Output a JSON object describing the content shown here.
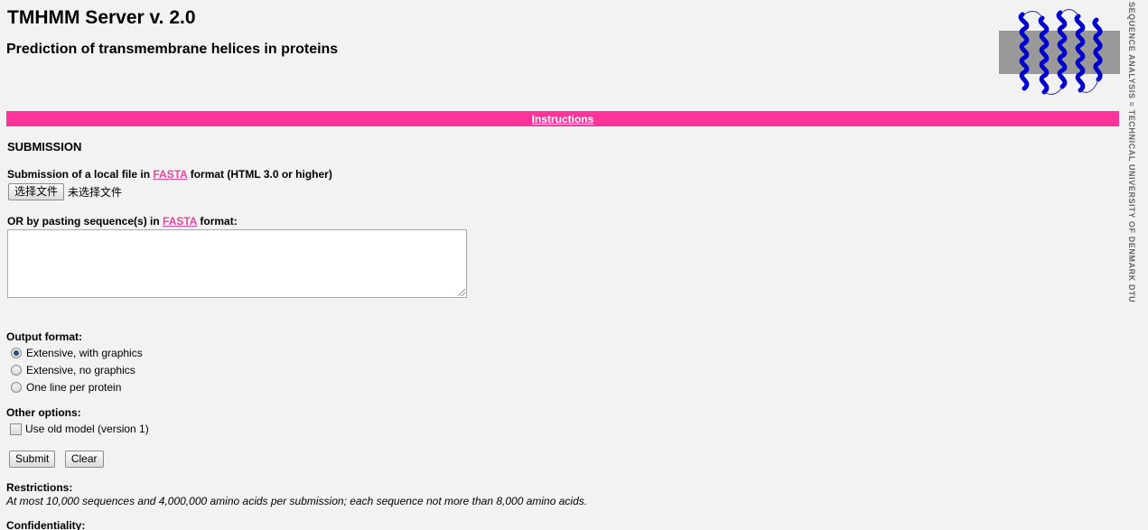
{
  "header": {
    "title": "TMHMM Server v. 2.0",
    "subtitle": "Prediction of transmembrane helices in proteins"
  },
  "sidebar": {
    "vertical_text": "SEQUENCE ANALYSIS ≡ TECHNICAL UNIVERSITY OF DENMARK DTU"
  },
  "logo": {
    "icon": "protein-helix-membrane-icon"
  },
  "nav_bar": {
    "instructions_link": "Instructions",
    "color": "#ff3399"
  },
  "submission": {
    "heading": "SUBMISSION",
    "file_label_prefix": "Submission of a local file in ",
    "file_label_link": "FASTA",
    "file_label_suffix": " format (HTML 3.0 or higher)",
    "choose_file_button": "选择文件",
    "no_file_chosen": "未选择文件",
    "paste_label_prefix": "OR by pasting sequence(s) in ",
    "paste_label_link": "FASTA",
    "paste_label_suffix": " format:",
    "sequence_value": ""
  },
  "output_format": {
    "label": "Output format:",
    "options": [
      {
        "label": "Extensive, with graphics",
        "checked": true
      },
      {
        "label": "Extensive, no graphics",
        "checked": false
      },
      {
        "label": "One line per protein",
        "checked": false
      }
    ]
  },
  "other_options": {
    "label": "Other options:",
    "old_model_label": "Use old model (version 1)",
    "old_model_checked": false
  },
  "actions": {
    "submit": "Submit",
    "clear": "Clear"
  },
  "restrictions": {
    "label": "Restrictions:",
    "text": "At most 10,000 sequences and 4,000,000 amino acids per submission; each sequence not more than 8,000 amino acids."
  },
  "confidentiality": {
    "label": "Confidentiality:"
  },
  "colors": {
    "link": "#e8479a",
    "background": "#f2f2f2",
    "helix": "#0000cc"
  }
}
